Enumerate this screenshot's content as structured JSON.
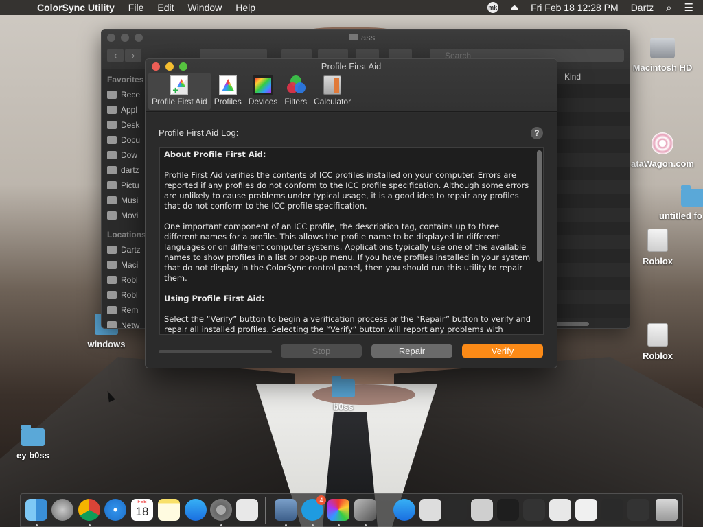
{
  "menubar": {
    "app_name": "ColorSync Utility",
    "items": [
      "File",
      "Edit",
      "Window",
      "Help"
    ],
    "clock": "Fri Feb 18  12:28 PM",
    "user": "Dartz",
    "mk_label": "mk"
  },
  "desktop": {
    "icons": {
      "macintosh_hd": "Macintosh HD",
      "datawagon": "ataWagon.com",
      "untitled": "untitled fo",
      "roblox1": "Roblox",
      "roblox2": "Roblox",
      "windows": "windows",
      "boss": "b0ss",
      "ey_boss": "ey b0ss"
    }
  },
  "finder": {
    "title": "ass",
    "search_placeholder": "Search",
    "favorites_header": "Favorites",
    "favorites": [
      "Rece",
      "Appl",
      "Desk",
      "Docu",
      "Dow",
      "dartz",
      "Pictu",
      "Musi",
      "Movi"
    ],
    "locations_header": "Locations",
    "locations": [
      "Dartz",
      "Maci",
      "Robl",
      "Robl",
      "Rem",
      "Netw"
    ],
    "column_kind": "Kind"
  },
  "colorsync": {
    "window_title": "Profile First Aid",
    "tabs": [
      {
        "label": "Profile First Aid"
      },
      {
        "label": "Profiles"
      },
      {
        "label": "Devices"
      },
      {
        "label": "Filters"
      },
      {
        "label": "Calculator"
      }
    ],
    "log_label": "Profile First Aid Log:",
    "help_glyph": "?",
    "log": {
      "h1": "About Profile First Aid:",
      "p1": "Profile First Aid verifies the contents of ICC profiles installed on your computer. Errors are reported if any profiles do not conform to the ICC profile specification. Although some errors are unlikely to cause problems under typical usage, it is a good idea to repair any profiles that do not conform to the ICC profile specification.",
      "p2": "One important component of an ICC profile, the description tag, contains up to three different names for a profile.  This allows the profile name to be displayed in different languages or on different computer systems.  Applications typically use one of the available names to show profiles in a list or pop-up menu.  If you have profiles installed in your system that do not display in the ColorSync control panel, then you should run this utility to repair them.",
      "h2": "Using Profile First Aid:",
      "p3": "Select the “Verify” button to begin a verification process or the “Repair” button to verify and repair all installed profiles.  Selecting the “Verify” button will report any problems with"
    },
    "buttons": {
      "stop": "Stop",
      "repair": "Repair",
      "verify": "Verify"
    },
    "progress": 0,
    "accent_color": "#fb8a17"
  },
  "dock": {
    "calendar_month": "FEB",
    "calendar_day": "18",
    "mk_badge": "4",
    "apps": [
      "finder-icon",
      "launchpad-icon",
      "chrome-icon",
      "safari-icon",
      "calendar-icon",
      "notes-icon",
      "app-store-icon",
      "system-preferences-icon",
      "roblox-icon",
      "preview-icon",
      "mk-icon",
      "colorsync-icon",
      "utilities-icon",
      "app-store-icon",
      "photo-icon",
      "window-thumb-icon",
      "trash-icon"
    ]
  }
}
